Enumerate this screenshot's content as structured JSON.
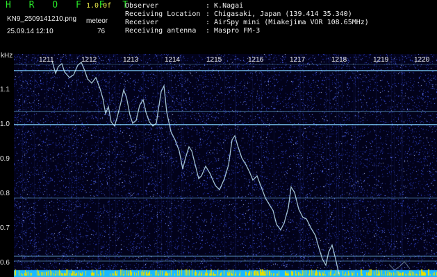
{
  "app": {
    "title": "H R O F F T",
    "version": "1.0.0f",
    "filename": "KN9_2509141210.png",
    "meteor_label": "meteor",
    "meteor_count": "76",
    "datetime": "25.09.14 12:10"
  },
  "info": {
    "rows": [
      {
        "label": "Observer",
        "value": ": K.Nagai"
      },
      {
        "label": "Receiving Location",
        "value": ": Chigasaki, Japan (139.414 35.340)"
      },
      {
        "label": "Receiver",
        "value": ": AirSpy mini (Miakejima VOR 108.65MHz)"
      },
      {
        "label": "Receiving antenna",
        "value": ": Maspro FM-3"
      }
    ]
  },
  "plot": {
    "y_unit": "kHz",
    "y_ticks": [
      "1.1",
      "1.0",
      "0.9",
      "0.8",
      "0.7",
      "0.6"
    ],
    "x_ticks": [
      "1211",
      "1212",
      "1213",
      "1214",
      "1215",
      "1216",
      "1217",
      "1218",
      "1219",
      "1220"
    ],
    "colors": {
      "background": "#02021a",
      "noise": "#3a4fd8",
      "carrier": "#7fd0ff",
      "trace": "#c9f0ff",
      "bottom_bar": "#1ab8ff",
      "peaks": "#e8e000"
    }
  }
}
